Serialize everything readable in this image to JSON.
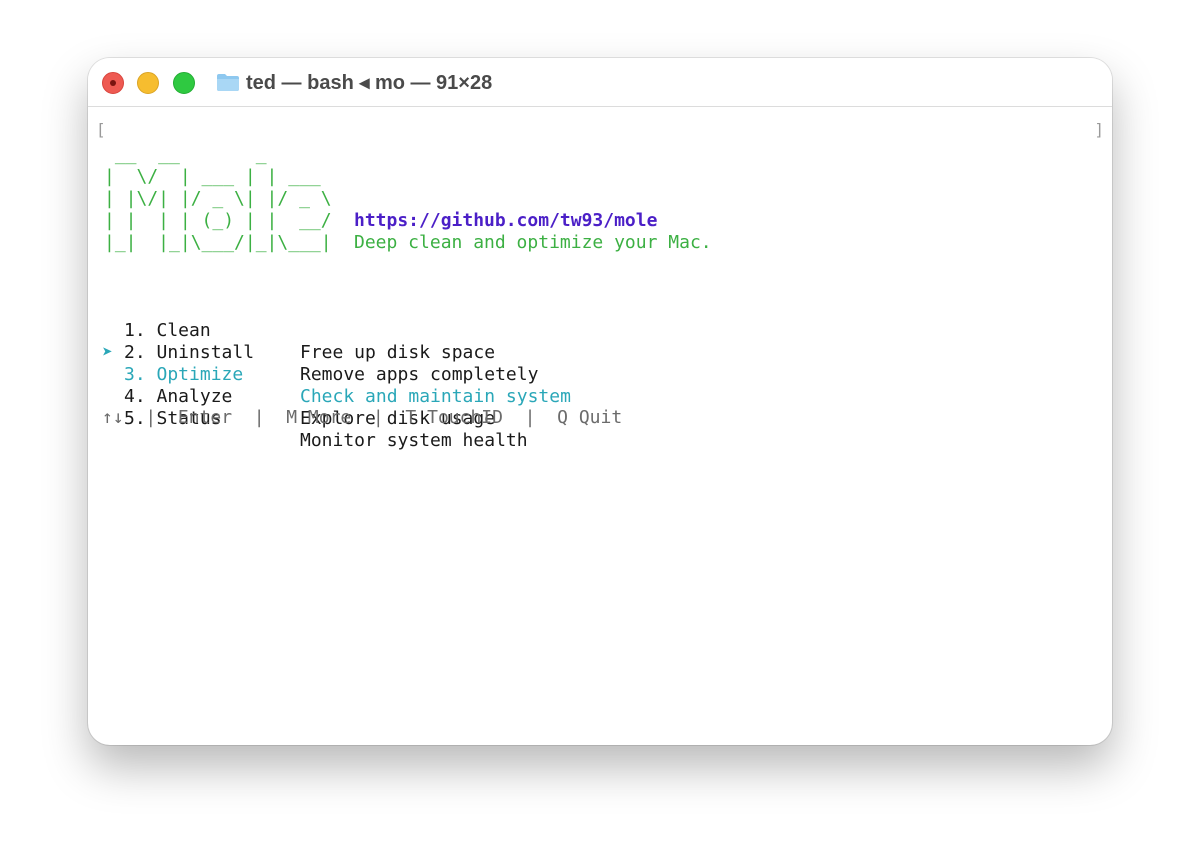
{
  "window": {
    "title": "ted — bash ◂ mo — 91×28"
  },
  "terminal": {
    "bracket_open": "[",
    "bracket_close": "]",
    "logo_ascii": " __  __       _\n|  \\/  | ___ | | ___\n| |\\/| |/ _ \\| |/ _ \\\n| |  | | (_) | |  __/\n|_|  |_|\\___/|_|\\___|",
    "url": "https://github.com/tw93/mole",
    "tagline": "Deep clean and optimize your Mac.",
    "menu": [
      {
        "label": "1. Clean",
        "desc": "Free up disk space",
        "pointer": ""
      },
      {
        "label": "2. Uninstall",
        "desc": "Remove apps completely",
        "pointer": ""
      },
      {
        "label": "3. Optimize",
        "desc": "Check and maintain system",
        "pointer": "➤"
      },
      {
        "label": "4. Analyze",
        "desc": "Explore disk usage",
        "pointer": ""
      },
      {
        "label": "5. Status",
        "desc": "Monitor system health",
        "pointer": ""
      }
    ],
    "footer": "↑↓  |  Enter  |  M More  |  T TouchID  |  Q Quit"
  },
  "colors": {
    "logo": "#3cb043",
    "url": "#4b1fc7",
    "selected": "#2aa7b8",
    "footer": "#6b6b6b"
  },
  "icons": {
    "folder": "folder-icon"
  }
}
